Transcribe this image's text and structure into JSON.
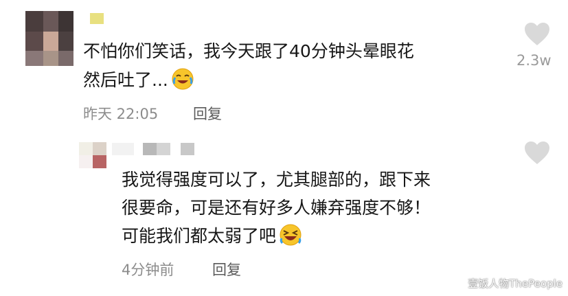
{
  "comment": {
    "line1": "不怕你们笑话，我今天跟了40分钟头晕眼花",
    "line2": "然后吐了...",
    "emoji_name": "crying-laughing-face",
    "time": "昨天 22:05",
    "reply_label": "回复",
    "like_count": "2.3w"
  },
  "reply": {
    "line1": "我觉得强度可以了，尤其腿部的，跟下来",
    "line2": "很要命，可是还有好多人嫌弃强度不够！",
    "line3": "可能我们都太弱了吧",
    "emoji_name": "rolling-laughing-face",
    "time": "4分钟前",
    "reply_label": "回复"
  },
  "watermark": "壹饭人物ThePeople",
  "colors": {
    "text": "#161616",
    "meta": "#8c8c8c",
    "heart": "#d9d9d9",
    "emoji_face": "#f7c52b"
  }
}
